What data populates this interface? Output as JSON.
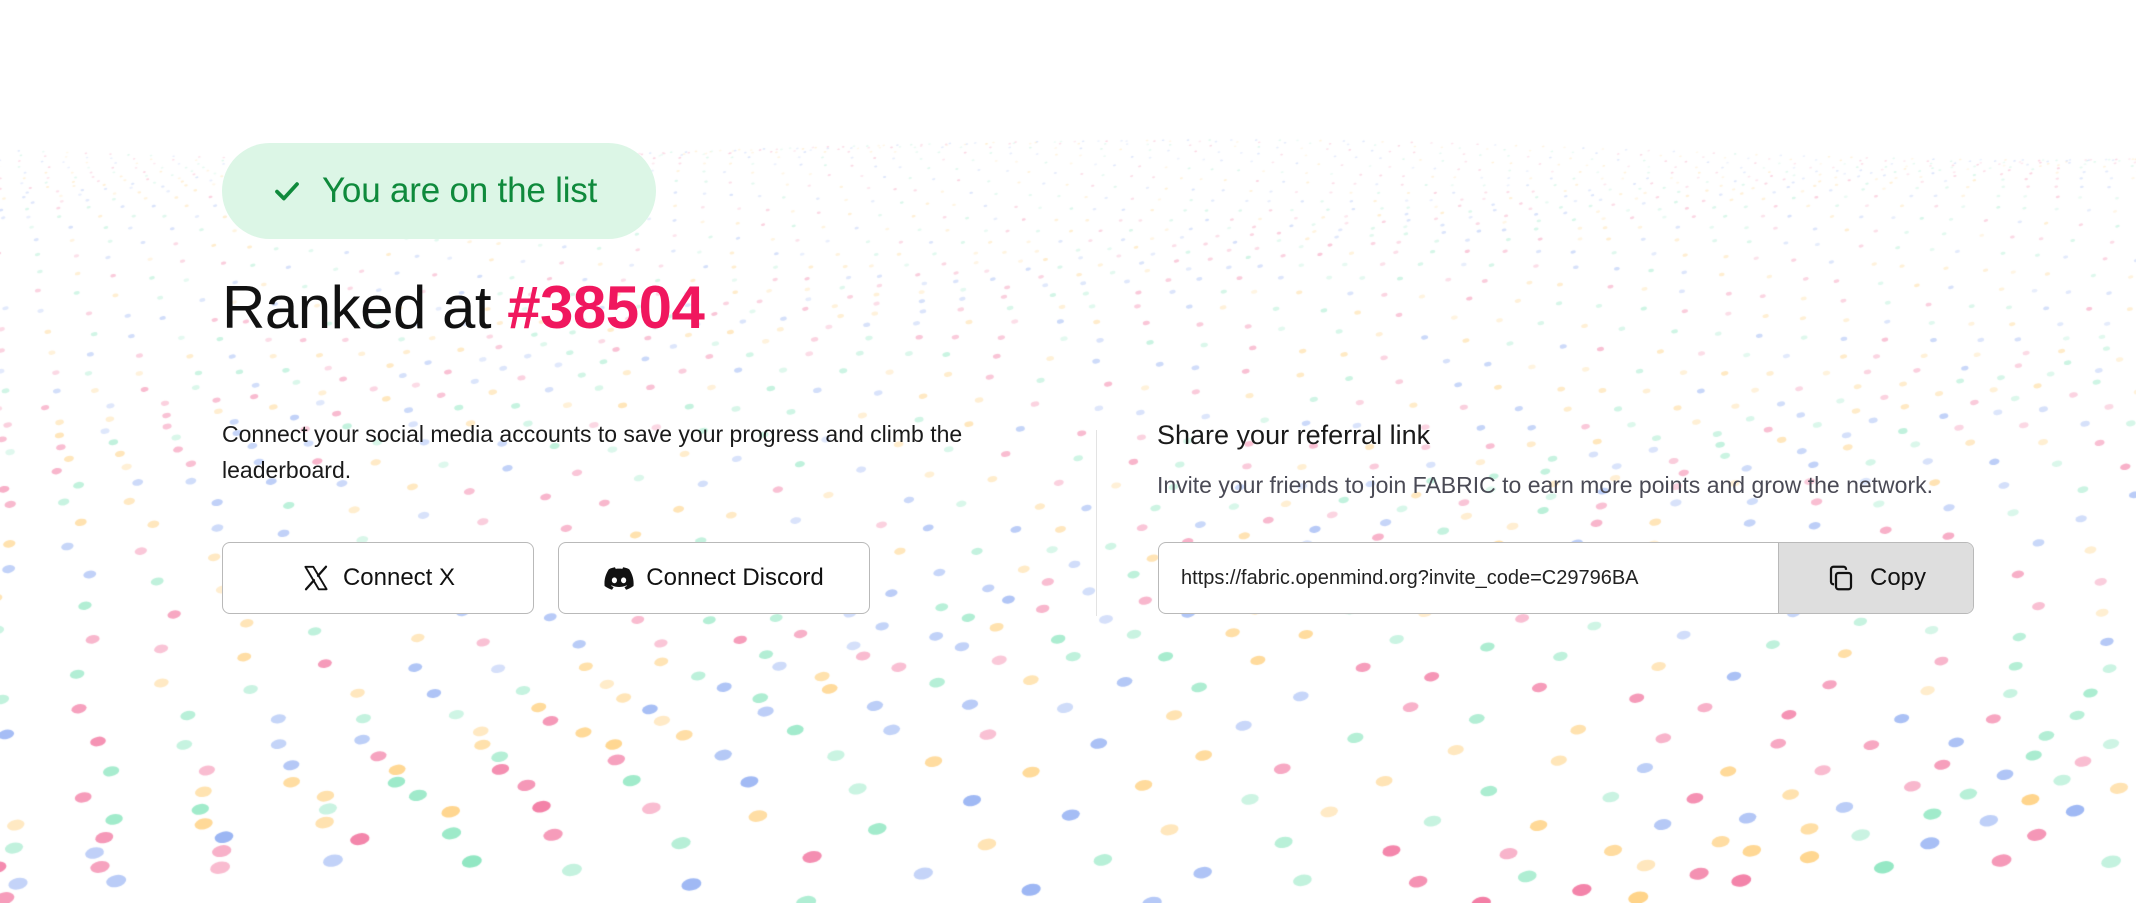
{
  "status": {
    "label": "You are on the list",
    "icon": "check-icon",
    "color": "#0f8a3c",
    "background": "#dcf6e6"
  },
  "rank": {
    "prefix": "Ranked at",
    "number": "#38504",
    "accent_color": "#f0175e"
  },
  "connect": {
    "description": "Connect your social media accounts to save your progress and climb the leaderboard.",
    "x_button_label": "Connect X",
    "x_icon": "x-logo-icon",
    "discord_button_label": "Connect Discord",
    "discord_icon": "discord-logo-icon"
  },
  "referral": {
    "title": "Share your referral link",
    "description": "Invite your friends to join FABRIC to earn more points and grow the network.",
    "link": "https://fabric.openmind.org?invite_code=C29796BA",
    "copy_label": "Copy",
    "copy_icon": "copy-icon"
  },
  "background": {
    "dot_colors": [
      "#f06292",
      "#ffc96b",
      "#7ea0f0",
      "#7ee3b8"
    ]
  }
}
